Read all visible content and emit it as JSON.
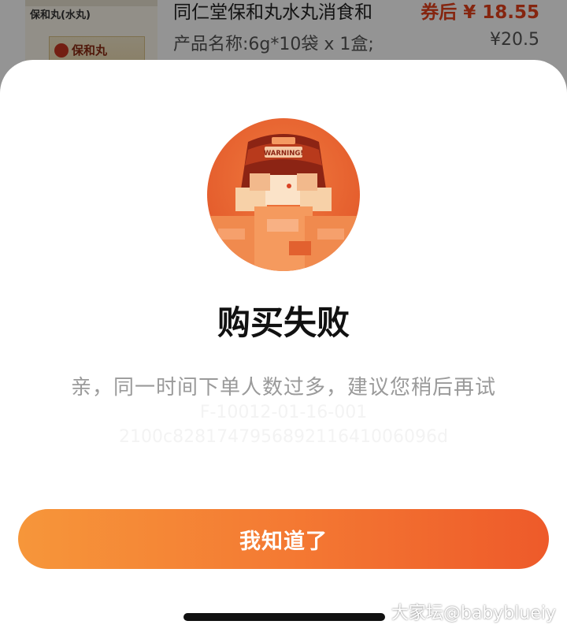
{
  "background_product": {
    "thumbnail_label": "保和丸(水丸)",
    "box_text": "保和丸",
    "title": "同仁堂保和丸水丸消食和",
    "coupon_price": "券后 ¥ 18.55",
    "spec": "产品名称:6g*10袋 x 1盒;",
    "original_price": "¥20.5"
  },
  "dialog": {
    "illustration_text": "WARNING!",
    "title": "购买失败",
    "message": "亲，同一时间下单人数过多，建议您稍后再试",
    "error_code": "F-10012-01-16-001",
    "trace_id": "2100c828174795689211641006096d",
    "confirm_label": "我知道了"
  },
  "watermark": "大家坛@babyblueiy",
  "colors": {
    "accent_start": "#f6963a",
    "accent_end": "#ee5a2a",
    "coupon_red": "#e5401a"
  }
}
